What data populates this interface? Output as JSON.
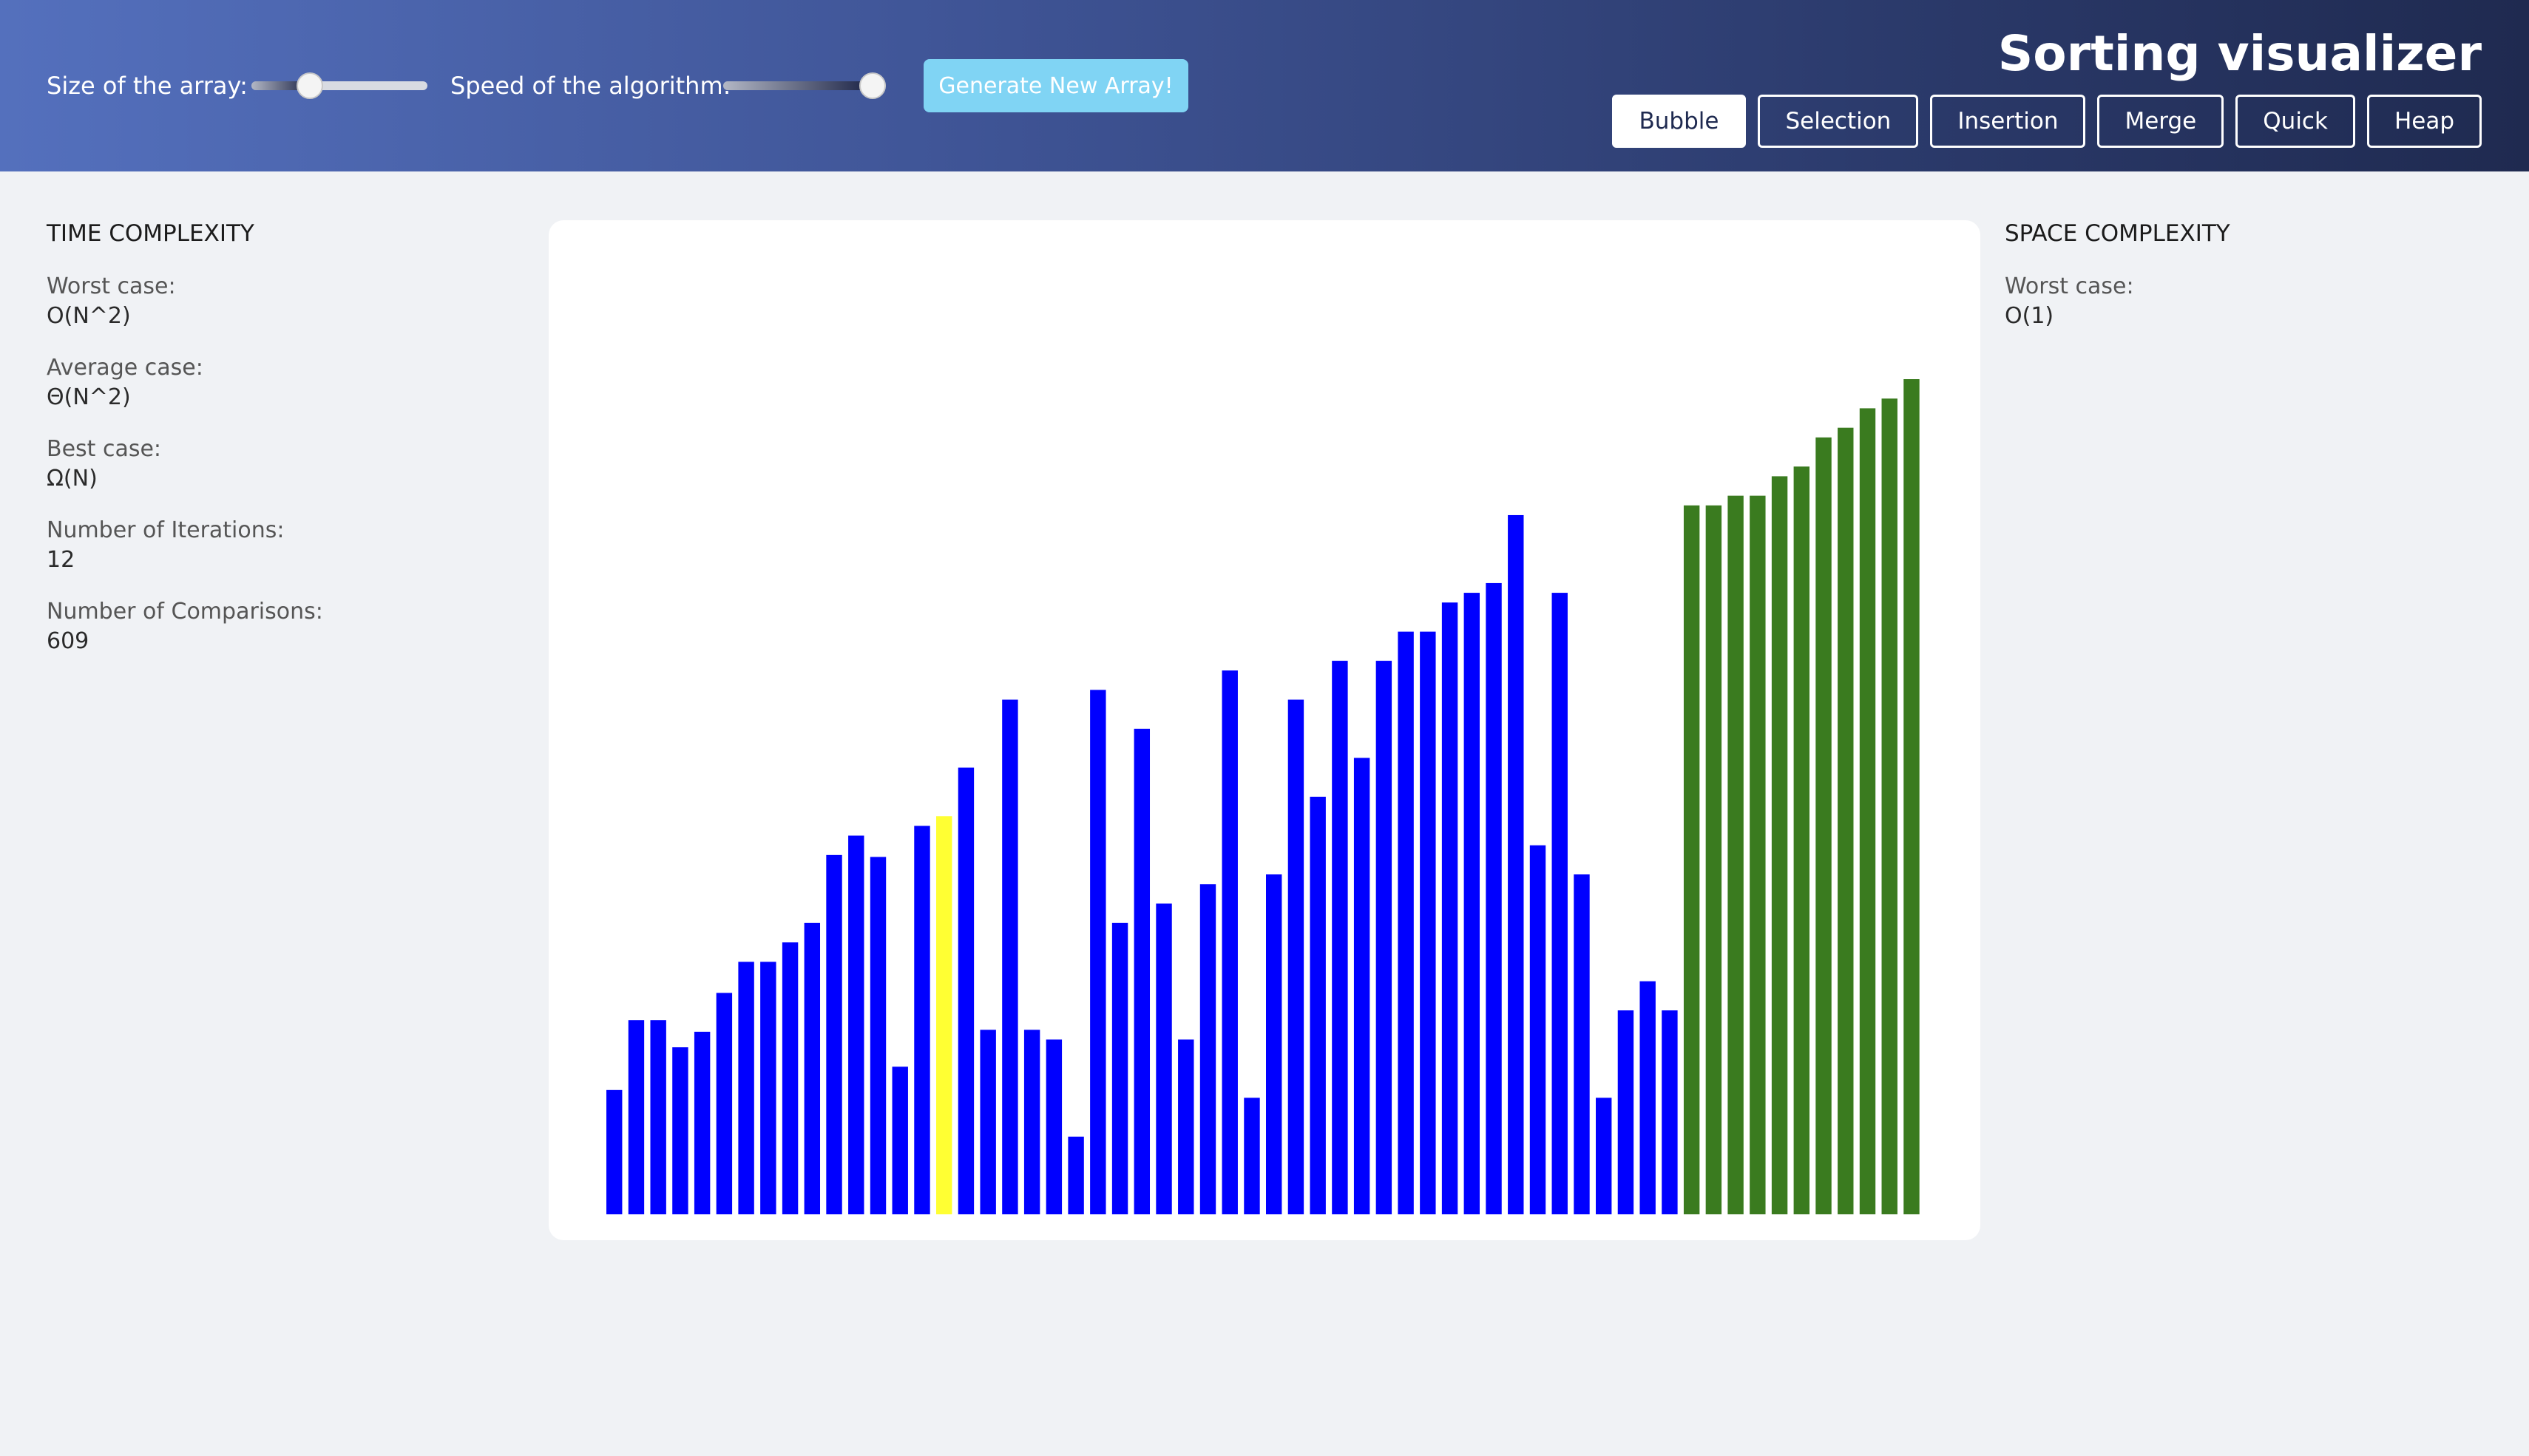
{
  "header": {
    "size_label": "Size of the array:",
    "speed_label": "Speed of the algorithm:",
    "size_value": 0.3,
    "speed_value": 1.0,
    "generate_label": "Generate New Array!",
    "title": "Sorting visualizer",
    "algorithms": [
      "Bubble",
      "Selection",
      "Insertion",
      "Merge",
      "Quick",
      "Heap"
    ],
    "active_algorithm": "Bubble"
  },
  "time_complexity": {
    "heading": "TIME COMPLEXITY",
    "worst_label": "Worst case:",
    "worst_value": "O(N^2)",
    "average_label": "Average case:",
    "average_value": "Θ(N^2)",
    "best_label": "Best case:",
    "best_value": "Ω(N)",
    "iterations_label": "Number of Iterations:",
    "iterations_value": "12",
    "comparisons_label": "Number of Comparisons:",
    "comparisons_value": "609"
  },
  "space_complexity": {
    "heading": "SPACE COMPLEXITY",
    "worst_label": "Worst case:",
    "worst_value": "O(1)"
  },
  "colors": {
    "unsorted": "#0000ff",
    "comparing": "#ffff33",
    "sorted": "#3a7b1f"
  },
  "chart_data": {
    "type": "bar",
    "values": [
      128,
      200,
      200,
      172,
      188,
      228,
      260,
      260,
      280,
      300,
      370,
      390,
      368,
      152,
      400,
      410,
      460,
      190,
      530,
      190,
      180,
      80,
      540,
      300,
      500,
      320,
      180,
      340,
      560,
      120,
      350,
      530,
      430,
      570,
      470,
      570,
      600,
      600,
      630,
      640,
      650,
      720,
      380,
      640,
      350,
      120,
      210,
      240,
      210,
      730,
      730,
      740,
      740,
      760,
      770,
      800,
      810,
      830,
      840,
      860
    ],
    "states": [
      "u",
      "u",
      "u",
      "u",
      "u",
      "u",
      "u",
      "u",
      "u",
      "u",
      "u",
      "u",
      "u",
      "u",
      "u",
      "c",
      "u",
      "u",
      "u",
      "u",
      "u",
      "u",
      "u",
      "u",
      "u",
      "u",
      "u",
      "u",
      "u",
      "u",
      "u",
      "u",
      "u",
      "u",
      "u",
      "u",
      "u",
      "u",
      "u",
      "u",
      "u",
      "u",
      "u",
      "u",
      "u",
      "u",
      "u",
      "u",
      "u",
      "s",
      "s",
      "s",
      "s",
      "s",
      "s",
      "s",
      "s",
      "s",
      "s",
      "s"
    ]
  }
}
